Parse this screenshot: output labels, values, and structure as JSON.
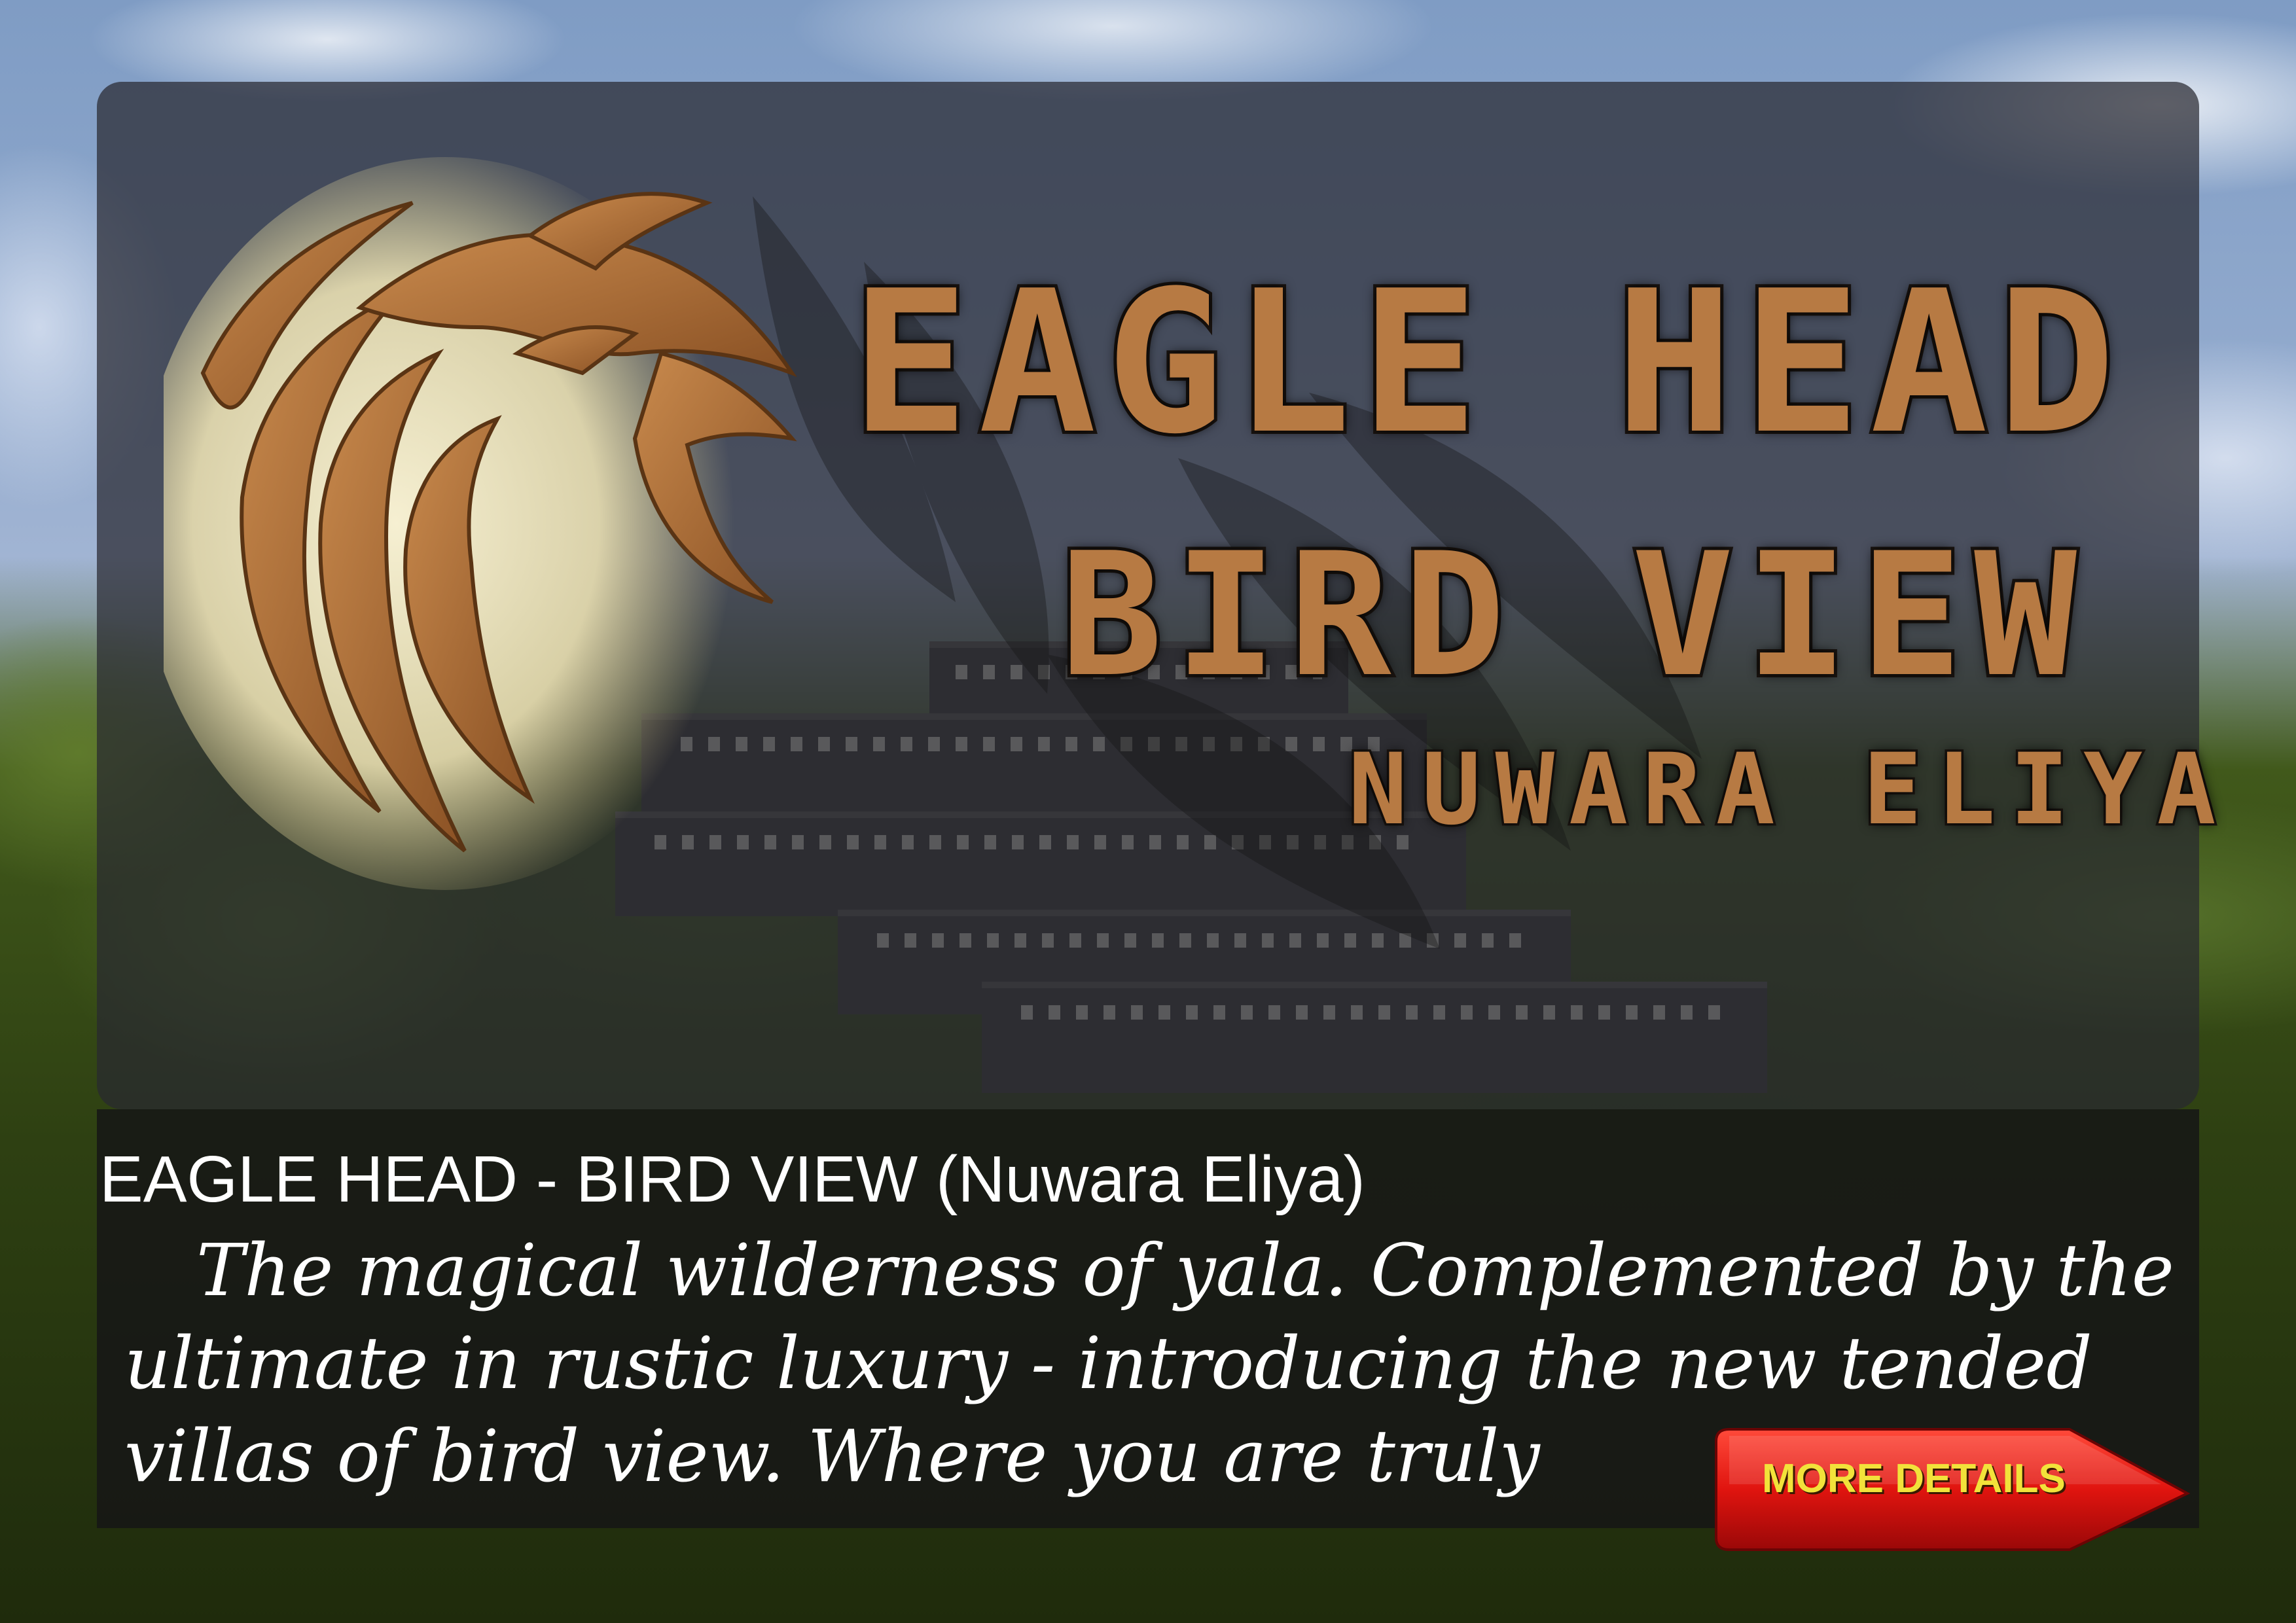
{
  "banner": {
    "title_line_1": "EAGLE HEAD",
    "title_line_2": "BIRD VIEW",
    "title_line_3": "NUWARA ELIYA"
  },
  "info": {
    "title": "EAGLE HEAD - BIRD VIEW (Nuwara Eliya)",
    "description_lines": [
      "The magical wilderness of yala. Complemented by the",
      "ultimate in rustic luxury - introducing the new tended",
      "villas of bird view. Where you are truly"
    ]
  },
  "more_button": {
    "label": "MORE DETAILS"
  },
  "colors": {
    "title_brown": "#b77a43",
    "button_red": "#e0140f",
    "button_text": "#f2e23a"
  },
  "icons": {
    "emblem": "eagle-head-emblem-icon",
    "more": "arrow-button-icon"
  }
}
